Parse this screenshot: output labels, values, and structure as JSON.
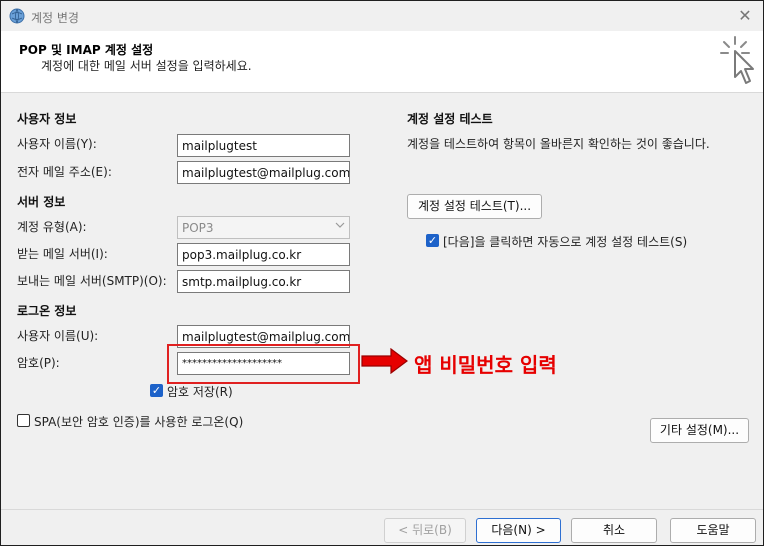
{
  "window": {
    "title": "계정 변경",
    "close_symbol": "✕"
  },
  "header": {
    "title": "POP 및 IMAP 계정 설정",
    "subtitle": "계정에 대한 메일 서버 설정을 입력하세요."
  },
  "user_info": {
    "section_title": "사용자 정보",
    "name_label": "사용자 이름(Y):",
    "name_value": "mailplugtest",
    "email_label": "전자 메일 주소(E):",
    "email_value": "mailplugtest@mailplug.com"
  },
  "server_info": {
    "section_title": "서버 정보",
    "account_type_label": "계정 유형(A):",
    "account_type_value": "POP3",
    "incoming_label": "받는 메일 서버(I):",
    "incoming_value": "pop3.mailplug.co.kr",
    "outgoing_label": "보내는 메일 서버(SMTP)(O):",
    "outgoing_value": "smtp.mailplug.co.kr"
  },
  "login_info": {
    "section_title": "로그온 정보",
    "username_label": "사용자 이름(U):",
    "username_value": "mailplugtest@mailplug.com",
    "password_label": "암호(P):",
    "password_value": "********************",
    "remember_label": "암호 저장(R)",
    "remember_checked": true,
    "spa_label": "SPA(보안 암호 인증)를 사용한 로그온(Q)",
    "spa_checked": false
  },
  "test": {
    "section_title": "계정 설정 테스트",
    "description": "계정을 테스트하여 항목이 올바른지 확인하는 것이 좋습니다.",
    "test_button": "계정 설정 테스트(T)...",
    "auto_test_label": "[다음]을 클릭하면 자동으로 계정 설정 테스트(S)",
    "auto_test_checked": true
  },
  "more_settings_button": "기타 설정(M)...",
  "annotation": {
    "text": "앱 비밀번호 입력",
    "color": "#e60000"
  },
  "footer": {
    "back_button": "< 뒤로(B)",
    "next_button": "다음(N) >",
    "cancel_button": "취소",
    "help_button": "도움말"
  },
  "icons": {
    "app": "outlook-globe-icon",
    "header": "click-cursor-icon",
    "checkmark": "✓",
    "dropdown": "chevron-down-icon"
  },
  "colors": {
    "accent": "#1d62c9",
    "annotation": "#e02020"
  }
}
